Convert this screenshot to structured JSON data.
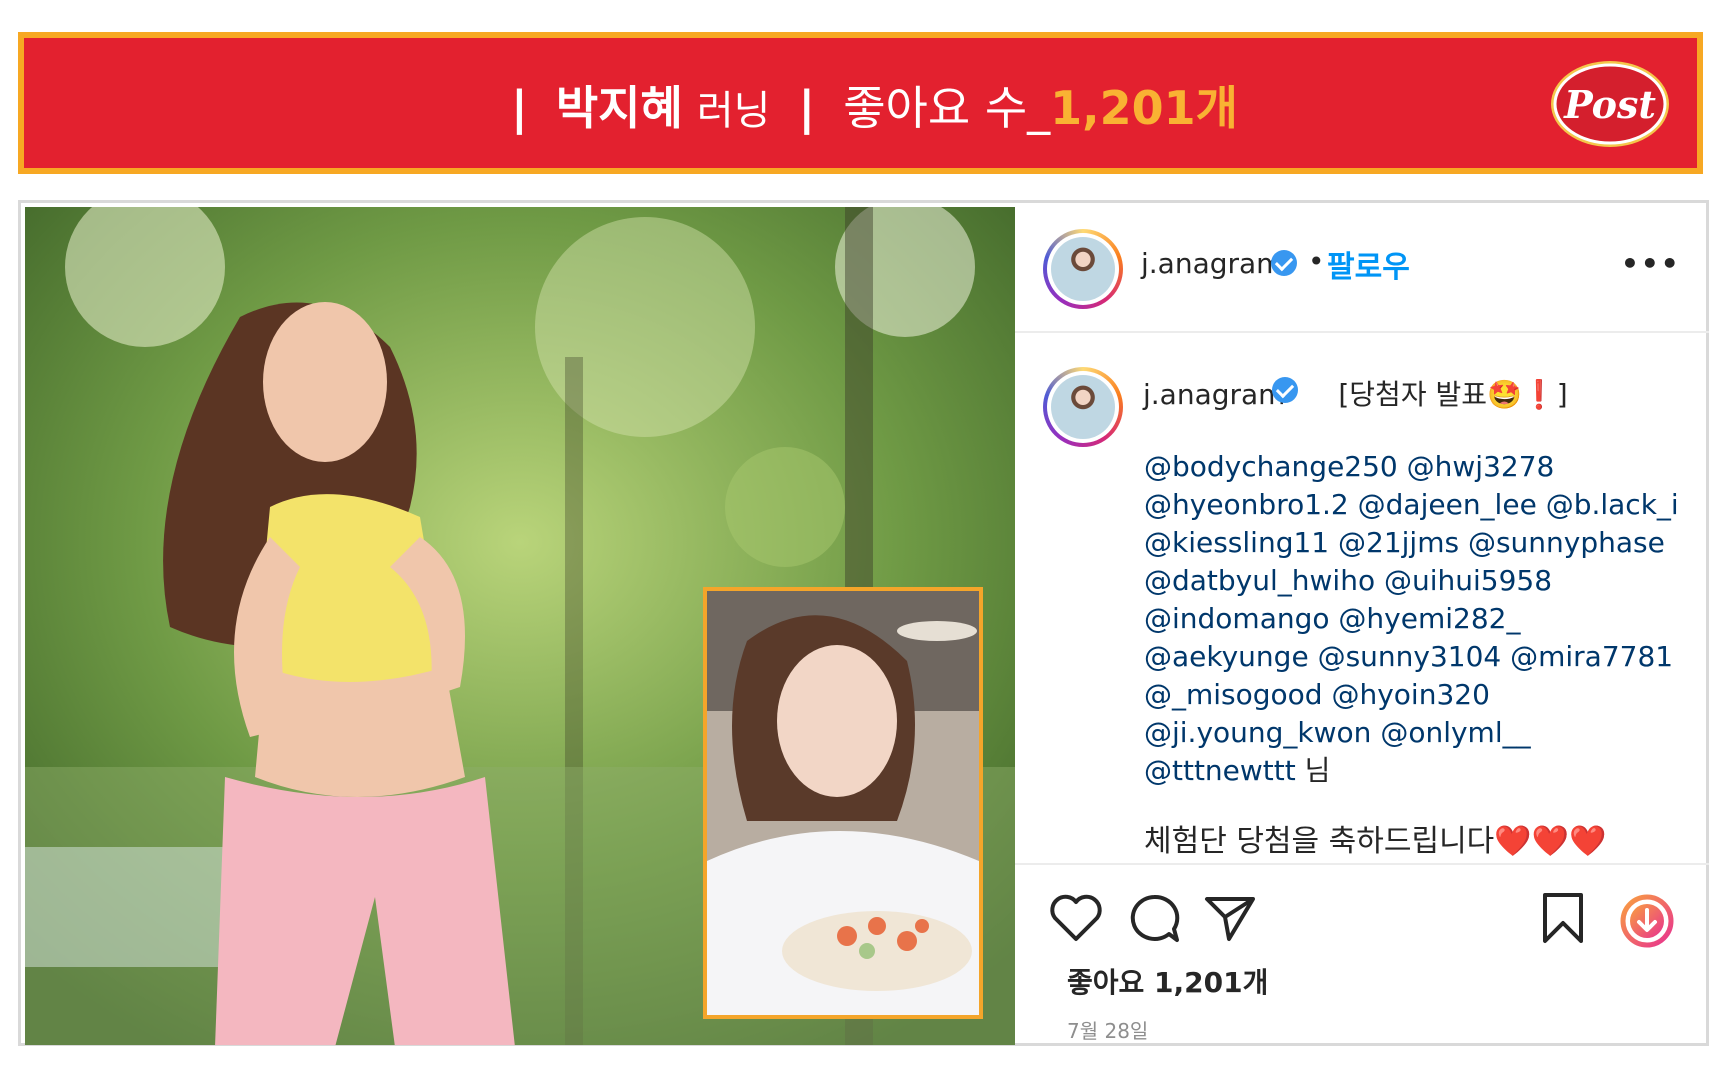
{
  "banner": {
    "separator": "|",
    "name": "박지혜",
    "activity": "러닝",
    "likes_label": "좋아요 수_",
    "likes_count": "1,201개",
    "brand_logo": "Post"
  },
  "post": {
    "username": "j.anagram",
    "follow_label": "팔로우",
    "dot": "•",
    "more_label": "•••",
    "caption_title": "[당첨자 발표🤩❗]",
    "mentions": [
      "@bodychange250 @hwj3278",
      "@hyeonbro1.2 @dajeen_lee @b.lack_i",
      "@kiessling11 @21jjms @sunnyphase",
      "@datbyul_hwiho @uihui5958",
      "@indomango @hyemi282_",
      "@aekyunge @sunny3104 @mira7781",
      "@_misogood @hyoin320",
      "@ji.young_kwon @onlyml__",
      "@tttnewttt"
    ],
    "mentions_suffix": " 님",
    "closing": "체험단 당첨을 축하드립니다❤️❤️❤️",
    "likes": "좋아요 1,201개",
    "date": "7월 28일"
  },
  "icons": [
    "verified-badge-icon",
    "heart-icon",
    "comment-icon",
    "share-icon",
    "bookmark-icon",
    "download-icon"
  ],
  "colors": {
    "banner_bg": "#e3212f",
    "banner_border": "#f7a823",
    "likes_highlight": "#f9b233",
    "follow_blue": "#0095f6",
    "mention_blue": "#00376b",
    "inset_border": "#f4a52a"
  }
}
